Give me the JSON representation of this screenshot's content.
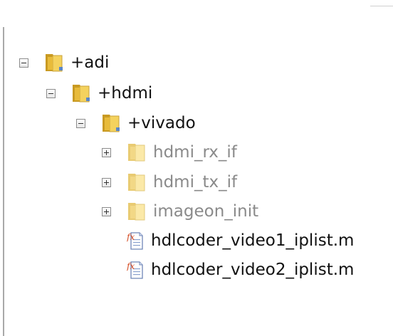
{
  "tree": {
    "items": [
      {
        "label": "+adi",
        "kind": "package",
        "expanded": true
      },
      {
        "label": "+hdmi",
        "kind": "package",
        "expanded": true
      },
      {
        "label": "+vivado",
        "kind": "package",
        "expanded": true
      },
      {
        "label": "hdmi_rx_if",
        "kind": "folder",
        "expanded": false
      },
      {
        "label": "hdmi_tx_if",
        "kind": "folder",
        "expanded": false
      },
      {
        "label": "imageon_init",
        "kind": "folder",
        "expanded": false
      },
      {
        "label": "hdlcoder_video1_iplist.m",
        "kind": "function-file"
      },
      {
        "label": "hdlcoder_video2_iplist.m",
        "kind": "function-file"
      }
    ]
  },
  "colors": {
    "folder_package": "#e3b73c",
    "folder_plain": "#f2dc8f",
    "label_dim": "#8a8a8a",
    "label_text": "#111111"
  },
  "icons": {
    "collapse": "minus-box-icon",
    "expand": "plus-box-icon",
    "package_folder": "package-folder-icon",
    "folder": "folder-icon",
    "function_file": "function-file-icon"
  }
}
